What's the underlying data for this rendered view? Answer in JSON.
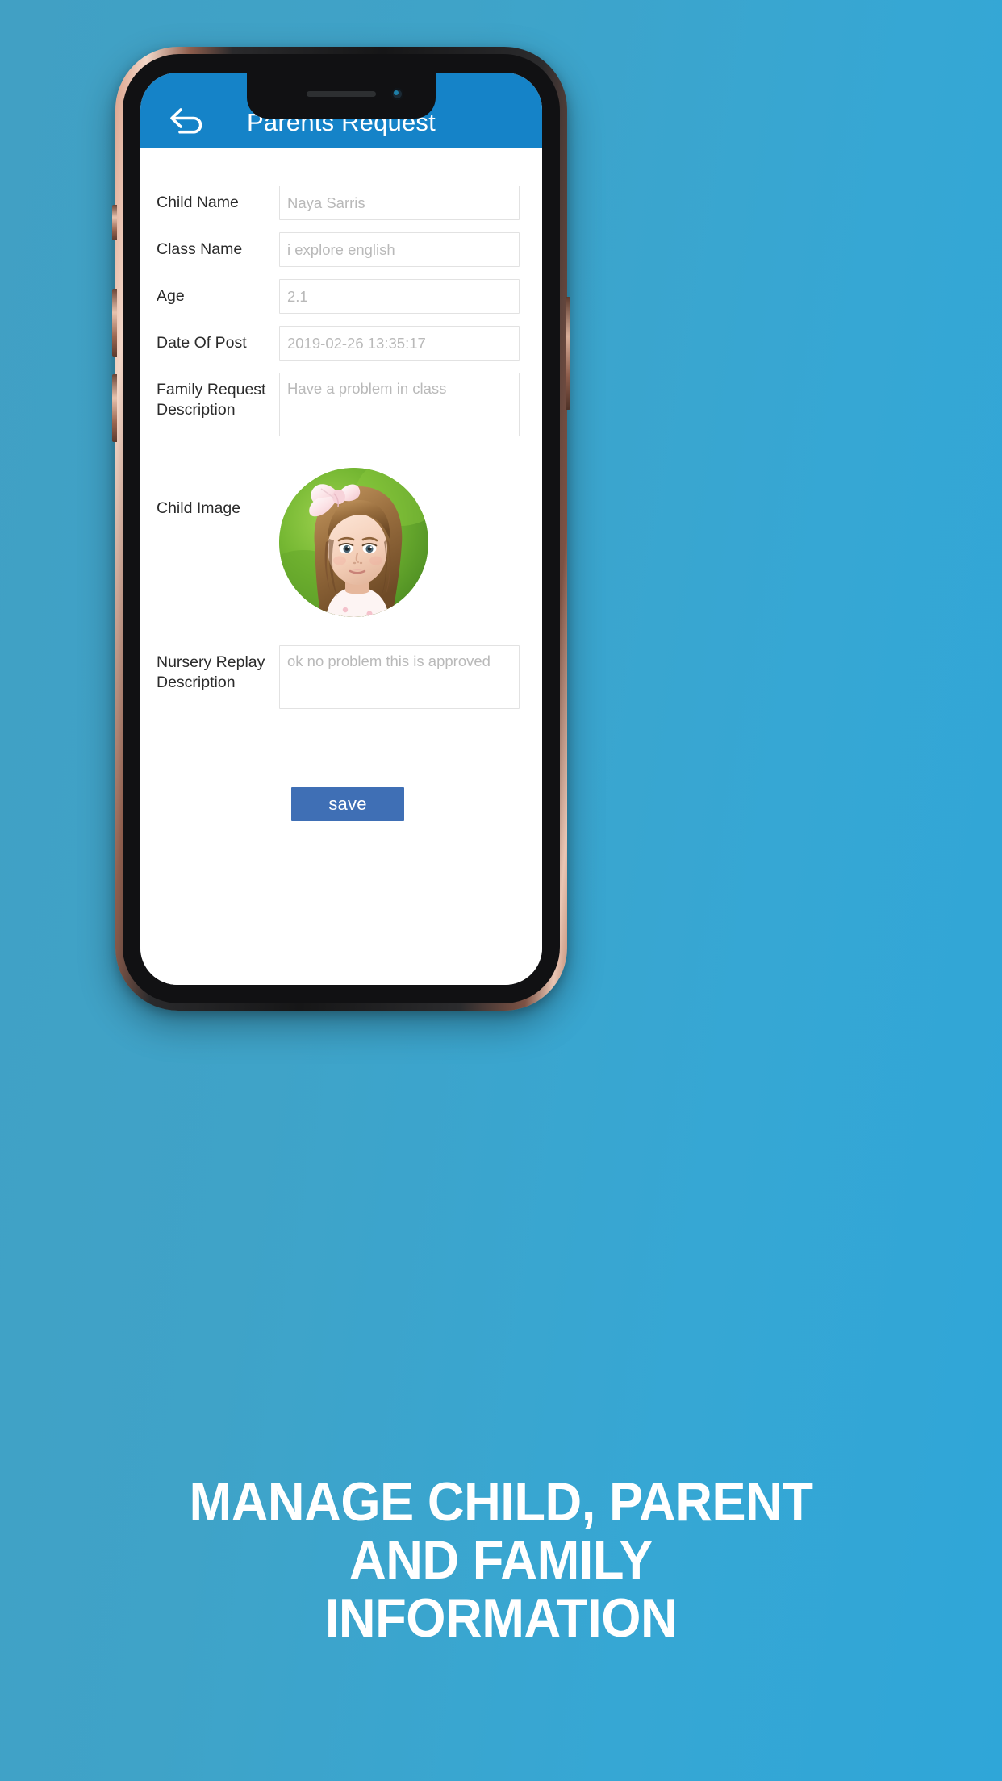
{
  "background": {
    "color_from": "#41a0c4",
    "color_to": "#2fa6d8"
  },
  "phone": {
    "frame_color": "#161617",
    "accent_color": "#c08a72"
  },
  "app": {
    "header": {
      "title": "Parents Request",
      "background_color": "#1583c8",
      "back_icon": "back-arrow-icon"
    },
    "form": {
      "fields": [
        {
          "label": "Child Name",
          "placeholder": "Naya Sarris",
          "type": "input"
        },
        {
          "label": "Class Name",
          "placeholder": "i explore english",
          "type": "input"
        },
        {
          "label": "Age",
          "placeholder": "2.1",
          "type": "input"
        },
        {
          "label": "Date Of Post",
          "placeholder": "2019-02-26 13:35:17",
          "type": "input"
        },
        {
          "label": "Family Request Description",
          "placeholder": "Have a problem in class",
          "type": "textarea"
        }
      ],
      "child_image": {
        "label": "Child Image",
        "alt": "child-photo-toddler-with-pink-bow"
      },
      "nursery": {
        "label": "Nursery Replay Description",
        "placeholder": "ok no problem this is approved"
      },
      "save_label": "save",
      "save_color": "#3f6fb5"
    }
  },
  "caption": {
    "line1": "MANAGE CHILD, PARENT",
    "line2": "AND FAMILY",
    "line3": "INFORMATION",
    "color": "#ffffff"
  }
}
